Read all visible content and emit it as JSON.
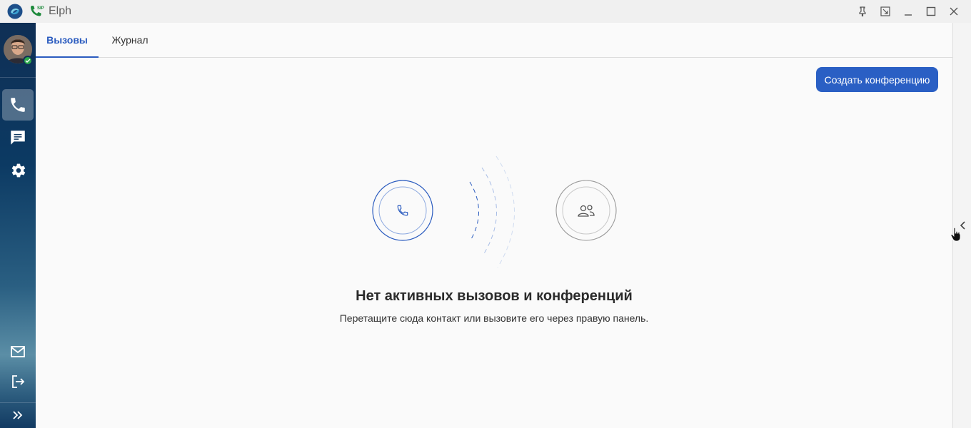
{
  "window": {
    "title": "Elph",
    "controls": [
      "pin-icon",
      "restore-icon",
      "minimize-icon",
      "maximize-icon",
      "close-icon"
    ]
  },
  "sidebar": {
    "user_status": "online",
    "top_items": [
      {
        "name": "calls",
        "icon": "phone-icon",
        "active": true
      },
      {
        "name": "chat",
        "icon": "chat-icon",
        "active": false
      },
      {
        "name": "settings",
        "icon": "gear-icon",
        "active": false
      }
    ],
    "bottom_items": [
      {
        "name": "mail",
        "icon": "mail-icon"
      },
      {
        "name": "logout",
        "icon": "logout-icon"
      },
      {
        "name": "expand",
        "icon": "double-chevron-right-icon"
      }
    ]
  },
  "tabs": {
    "calls": "Вызовы",
    "journal": "Журнал"
  },
  "toolbar": {
    "create_conference": "Создать конференцию"
  },
  "empty_state": {
    "title": "Нет активных вызовов и конференций",
    "subtitle": "Перетащите сюда контакт или вызовите его через правую панель."
  },
  "colors": {
    "accent": "#2a5bbf",
    "button": "#2a5fc4",
    "sidebar_top": "#0f2f55",
    "status_online": "#2ba84a"
  }
}
